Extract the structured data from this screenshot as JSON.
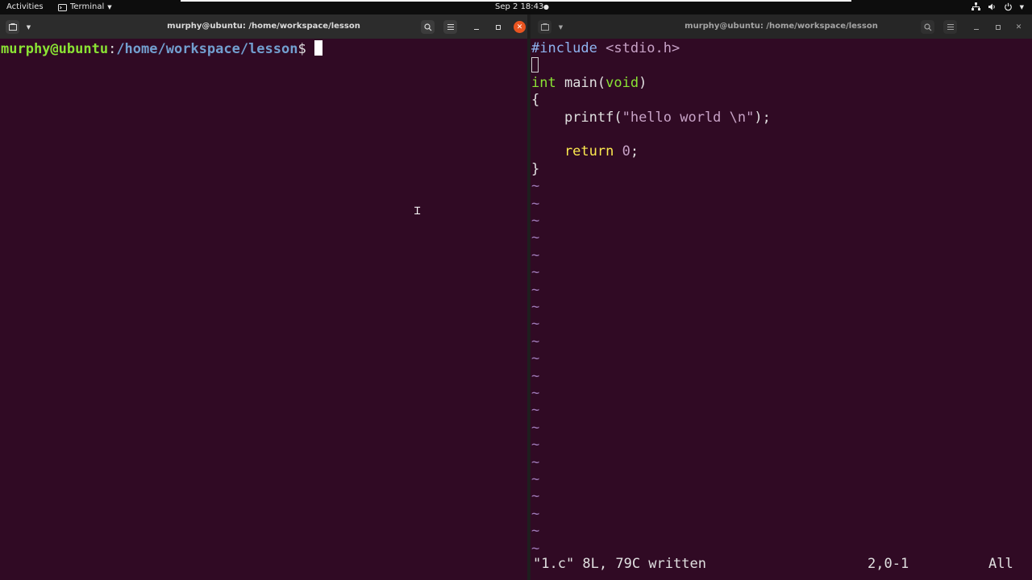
{
  "topbar": {
    "activities": "Activities",
    "app_menu": "Terminal",
    "clock": "Sep 2  18:43",
    "notification_dot": "●"
  },
  "left_window": {
    "title": "murphy@ubuntu: /home/workspace/lesson",
    "prompt_user_host": "murphy@ubuntu",
    "prompt_sep": ":",
    "prompt_path": "/home/workspace/lesson",
    "prompt_symbol": "$ "
  },
  "right_window": {
    "title": "murphy@ubuntu: /home/workspace/lesson",
    "code": {
      "l1_pre": "#include",
      "l1_hdr": " <stdio.h>",
      "l3_type": "int",
      "l3_mid": " main(",
      "l3_type2": "void",
      "l3_end": ")",
      "l4": "{",
      "l5_a": "    printf(",
      "l5_str": "\"hello world \\n\"",
      "l5_end": ");",
      "l7_kw": "    return",
      "l7_sp": " ",
      "l7_num": "0",
      "l7_end": ";",
      "l8": "}"
    },
    "tilde": "~",
    "status_message": "\"1.c\" 8L, 79C written",
    "cursor_position": "2,0-1",
    "scroll_indicator": "All"
  },
  "icons": [
    "terminal-tab-icon",
    "chevron-down-icon",
    "search-icon",
    "hamburger-menu-icon",
    "minimize-icon",
    "maximize-icon",
    "close-icon",
    "network-icon",
    "volume-icon",
    "power-icon"
  ]
}
